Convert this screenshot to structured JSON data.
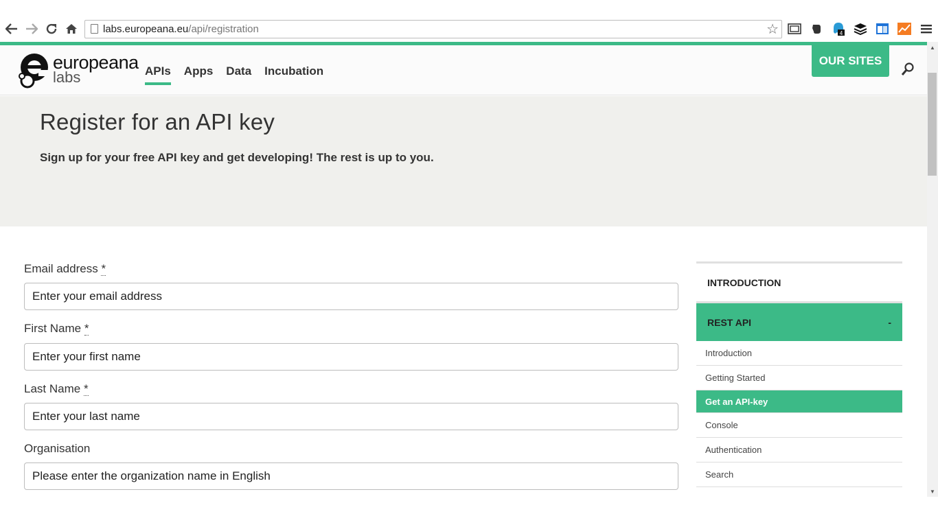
{
  "browser": {
    "url_host": "labs.europeana.eu",
    "url_path": "/api/registration",
    "extension_badge": "4"
  },
  "site": {
    "logo_word1": "europeana",
    "logo_word2": "labs",
    "nav": [
      "APIs",
      "Apps",
      "Data",
      "Incubation"
    ],
    "active_nav": "APIs",
    "our_sites": "OUR SITES",
    "accent_color": "#3cba87"
  },
  "hero": {
    "title": "Register for an API key",
    "subtitle": "Sign up for your free API key and get developing! The rest is up to you."
  },
  "form": {
    "email_label": "Email address",
    "email_placeholder": "Enter your email address",
    "first_label": "First Name",
    "first_placeholder": "Enter your first name",
    "last_label": "Last Name",
    "last_placeholder": "Enter your last name",
    "org_label": "Organisation",
    "org_placeholder": "Please enter the organization name in English",
    "required_mark": "*"
  },
  "sidebar": {
    "introduction": "INTRODUCTION",
    "rest_api": "REST API",
    "rest_toggle": "-",
    "links": [
      "Introduction",
      "Getting Started",
      "Get an API-key",
      "Console",
      "Authentication",
      "Search"
    ],
    "active_link": "Get an API-key"
  }
}
